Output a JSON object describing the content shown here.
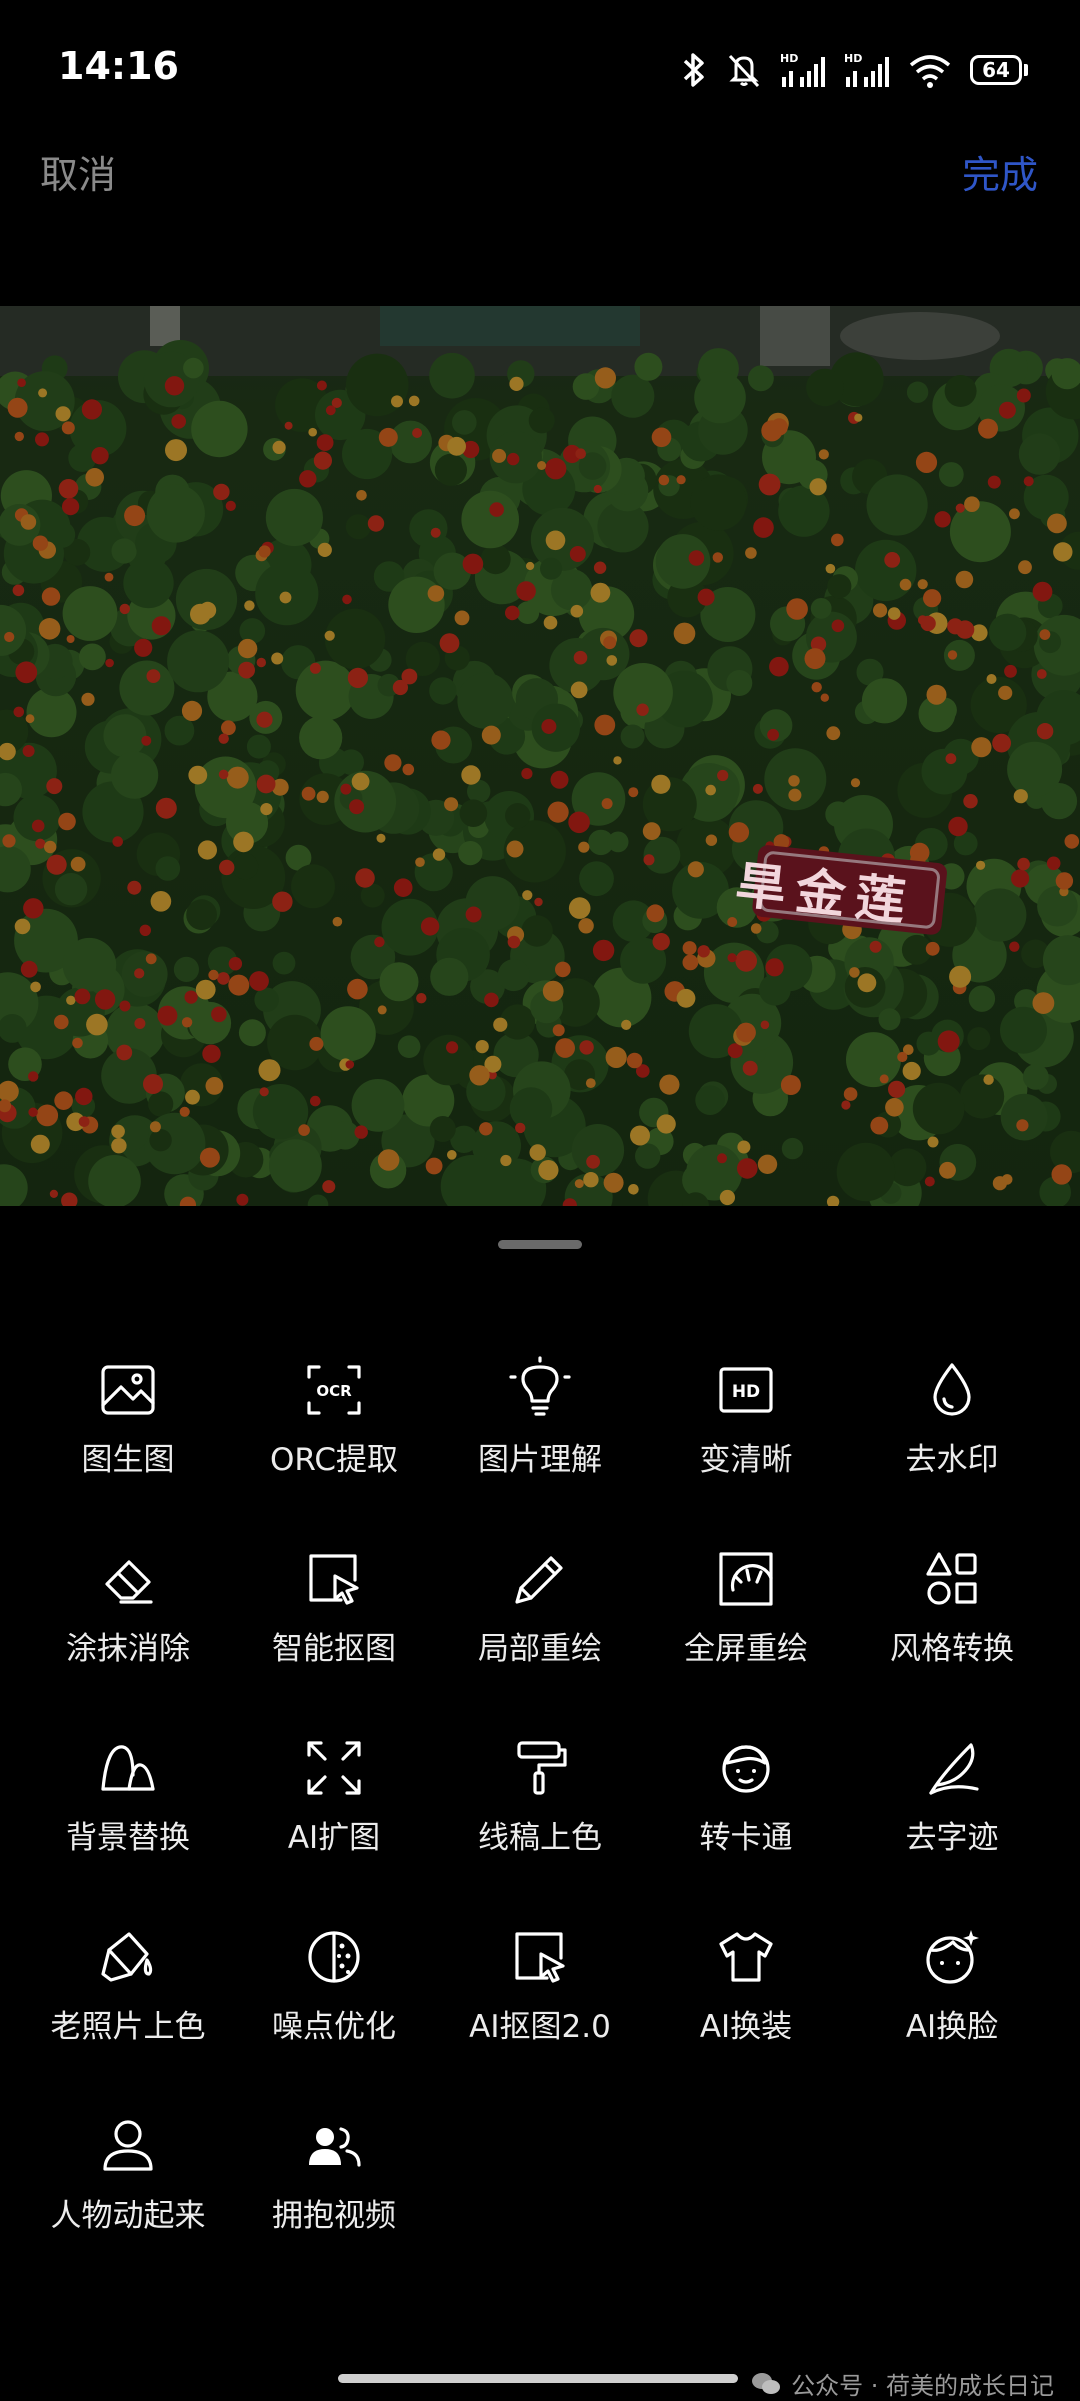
{
  "status_bar": {
    "time": "14:16",
    "network_badge_1": "HD",
    "network_badge_2": "HD",
    "battery_level": "64",
    "icons": [
      "bluetooth-icon",
      "mute-icon",
      "signal-icon",
      "signal-icon",
      "wifi-icon",
      "battery-icon"
    ]
  },
  "header": {
    "cancel_label": "取消",
    "done_label": "完成",
    "done_color": "#2f56c8"
  },
  "photo": {
    "sign_text": "旱金莲"
  },
  "tools": [
    {
      "label": "图生图",
      "icon": "image-icon"
    },
    {
      "label": "ORC提取",
      "icon": "ocr-icon"
    },
    {
      "label": "图片理解",
      "icon": "lightbulb-icon"
    },
    {
      "label": "变清晰",
      "icon": "hd-icon"
    },
    {
      "label": "去水印",
      "icon": "droplet-icon"
    },
    {
      "label": "涂抹消除",
      "icon": "eraser-icon"
    },
    {
      "label": "智能抠图",
      "icon": "select-cursor-icon"
    },
    {
      "label": "局部重绘",
      "icon": "pencil-icon"
    },
    {
      "label": "全屏重绘",
      "icon": "sun-frame-icon"
    },
    {
      "label": "风格转换",
      "icon": "shapes-icon"
    },
    {
      "label": "背景替换",
      "icon": "mountain-icon"
    },
    {
      "label": "AI扩图",
      "icon": "expand-icon"
    },
    {
      "label": "线稿上色",
      "icon": "paint-roller-icon"
    },
    {
      "label": "转卡通",
      "icon": "cartoon-face-icon"
    },
    {
      "label": "去字迹",
      "icon": "quill-icon"
    },
    {
      "label": "老照片上色",
      "icon": "paint-bucket-icon"
    },
    {
      "label": "噪点优化",
      "icon": "noise-icon"
    },
    {
      "label": "AI抠图2.0",
      "icon": "select-cursor-icon"
    },
    {
      "label": "AI换装",
      "icon": "tshirt-icon"
    },
    {
      "label": "AI换脸",
      "icon": "face-swap-icon"
    },
    {
      "label": "人物动起来",
      "icon": "person-icon"
    },
    {
      "label": "拥抱视频",
      "icon": "two-people-icon"
    }
  ],
  "footer": {
    "watermark_text": "公众号 · 荷美的成长日记",
    "watermark_icon": "wechat-icon"
  },
  "colors": {
    "background": "#000000",
    "cancel": "#8a8a8a",
    "accent": "#2f56c8"
  }
}
